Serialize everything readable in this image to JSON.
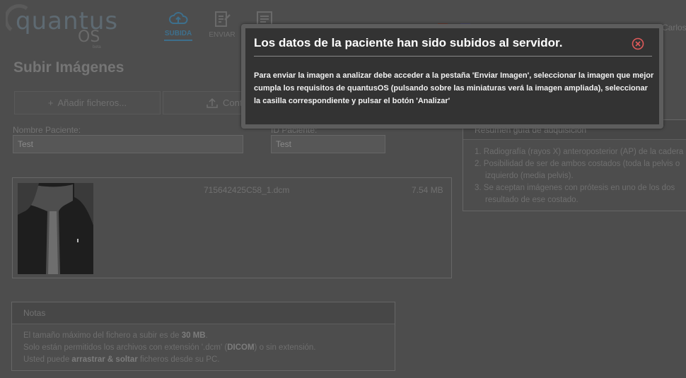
{
  "logo": {
    "word": "quantus",
    "os": "OS",
    "beta": "beta"
  },
  "nav": {
    "subida": "SUBIDA",
    "enviar": "ENVIAR"
  },
  "user": {
    "name": "Carlos"
  },
  "page": {
    "title": "Subir Imágenes"
  },
  "actions": {
    "add_files": "Añadir ficheros...",
    "continue": "Conti"
  },
  "form": {
    "name_label": "Nombre Paciente:",
    "name_value": "Test",
    "id_label": "ID Paciente:",
    "id_value": "Test"
  },
  "file": {
    "name": "715642425C58_1.dcm",
    "size": "7.54 MB"
  },
  "guide": {
    "title": "Resumen guía de adquisición",
    "lines": [
      "1. Radiografía (rayos X) anteroposterior (AP) de la cadera",
      "2. Posibilidad de ser de ambos costados (toda la pelvis o",
      "izquierdo (media pelvis).",
      "3. Se aceptan imágenes con prótesis en uno de los dos",
      "resultado de ese costado."
    ]
  },
  "notes": {
    "title": "Notas",
    "line1_pre": "El tamaño máximo del fichero a subir es de ",
    "line1_bold": "30 MB",
    "line1_post": ".",
    "line2_pre": "Solo están permitidos los archivos con extensión '.dcm' (",
    "line2_bold": "DICOM",
    "line2_post": ") o sin extensión.",
    "line3_pre": "Usted puede ",
    "line3_bold": "arrastrar & soltar",
    "line3_post": " ficheros desde su PC."
  },
  "modal": {
    "title": "Los datos de la paciente han sido subidos al servidor.",
    "body": "Para enviar la imagen a analizar debe acceder a la pestaña 'Enviar Imagen', seleccionar la imagen que mejor cumpla los requisitos de quantusOS (pulsando sobre las miniaturas verá la imagen ampliada), seleccionar la casilla correspondiente y pulsar el botón 'Analizar'"
  },
  "colors": {
    "accent": "#3d6f8c",
    "close": "#e05a5a",
    "modal_bg": "#333333"
  },
  "icons": [
    "cloud-upload-icon",
    "send-doc-icon",
    "doc-list-icon",
    "plus-icon",
    "upload-icon",
    "close-circle-icon"
  ]
}
